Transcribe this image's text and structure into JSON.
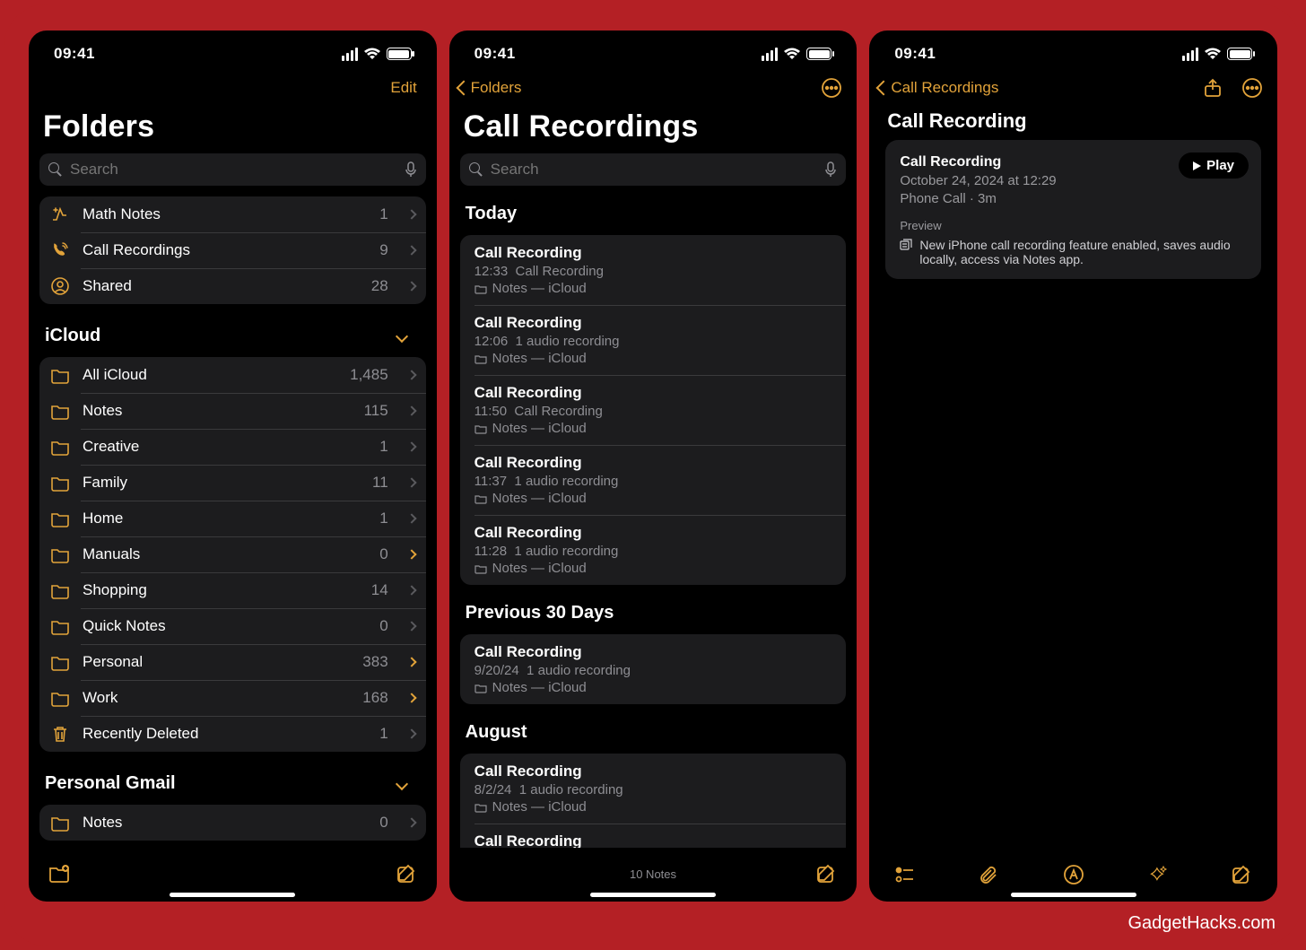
{
  "watermark": "GadgetHacks.com",
  "status": {
    "time": "09:41"
  },
  "search": {
    "placeholder": "Search"
  },
  "screen1": {
    "edit": "Edit",
    "title": "Folders",
    "smart_folders": [
      {
        "icon": "math",
        "label": "Math Notes",
        "count": "1",
        "chev": "grey"
      },
      {
        "icon": "phone",
        "label": "Call Recordings",
        "count": "9",
        "chev": "grey"
      },
      {
        "icon": "shared",
        "label": "Shared",
        "count": "28",
        "chev": "grey"
      }
    ],
    "section": "iCloud",
    "icloud": [
      {
        "label": "All iCloud",
        "count": "1,485",
        "chev": "grey"
      },
      {
        "label": "Notes",
        "count": "115",
        "chev": "grey"
      },
      {
        "label": "Creative",
        "count": "1",
        "chev": "grey"
      },
      {
        "label": "Family",
        "count": "11",
        "chev": "grey"
      },
      {
        "label": "Home",
        "count": "1",
        "chev": "grey"
      },
      {
        "label": "Manuals",
        "count": "0",
        "chev": "gold"
      },
      {
        "label": "Shopping",
        "count": "14",
        "chev": "grey"
      },
      {
        "label": "Quick Notes",
        "count": "0",
        "chev": "grey"
      },
      {
        "label": "Personal",
        "count": "383",
        "chev": "gold"
      },
      {
        "label": "Work",
        "count": "168",
        "chev": "gold"
      },
      {
        "label": "Recently Deleted",
        "count": "1",
        "chev": "grey",
        "icon": "trash"
      }
    ],
    "section2": "Personal Gmail",
    "gmail": [
      {
        "label": "Notes",
        "count": "0",
        "chev": "grey"
      }
    ]
  },
  "screen2": {
    "back": "Folders",
    "title": "Call Recordings",
    "groups": [
      {
        "head": "Today",
        "items": [
          {
            "t1": "Call Recording",
            "time": "12:33",
            "sub": "Call Recording",
            "loc": "Notes — iCloud"
          },
          {
            "t1": "Call Recording",
            "time": "12:06",
            "sub": "1 audio recording",
            "loc": "Notes — iCloud"
          },
          {
            "t1": "Call Recording",
            "time": "11:50",
            "sub": "Call Recording",
            "loc": "Notes — iCloud"
          },
          {
            "t1": "Call Recording",
            "time": "11:37",
            "sub": "1 audio recording",
            "loc": "Notes — iCloud"
          },
          {
            "t1": "Call Recording",
            "time": "11:28",
            "sub": "1 audio recording",
            "loc": "Notes — iCloud"
          }
        ]
      },
      {
        "head": "Previous 30 Days",
        "items": [
          {
            "t1": "Call Recording",
            "time": "9/20/24",
            "sub": "1 audio recording",
            "loc": "Notes — iCloud"
          }
        ]
      },
      {
        "head": "August",
        "items": [
          {
            "t1": "Call Recording",
            "time": "8/2/24",
            "sub": "1 audio recording",
            "loc": "Notes — iCloud"
          },
          {
            "t1": "Call Recording",
            "time": "",
            "sub": "",
            "loc": ""
          }
        ]
      }
    ],
    "footer": "10 Notes"
  },
  "screen3": {
    "back": "Call Recordings",
    "title": "Call Recording",
    "card": {
      "title": "Call Recording",
      "date": "October 24, 2024 at 12:29",
      "source": "Phone Call · 3m",
      "play": "Play",
      "preview_label": "Preview",
      "preview_body": "New iPhone call recording feature enabled, saves audio locally, access via Notes app."
    }
  }
}
